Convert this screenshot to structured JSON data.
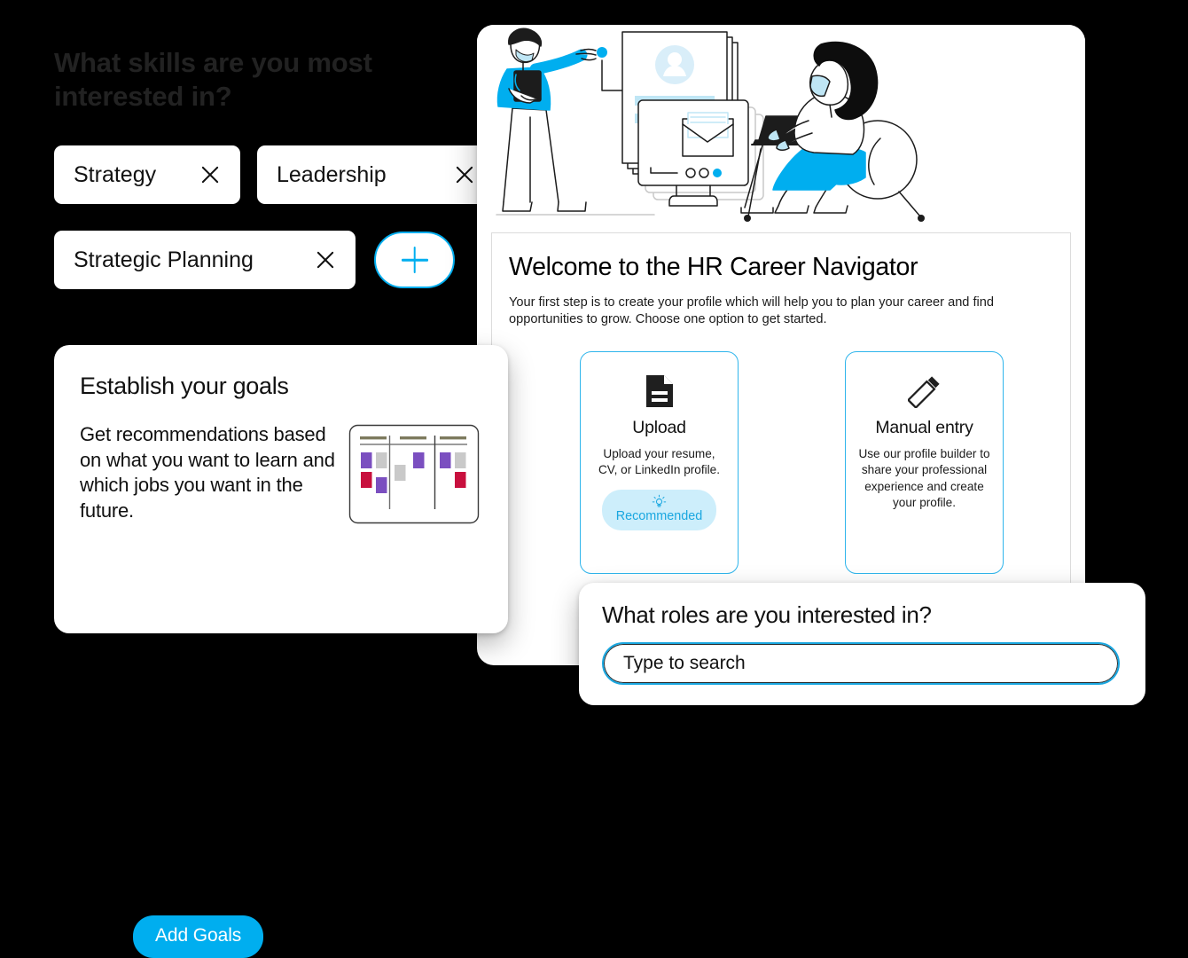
{
  "skills_panel": {
    "heading": "What skills are you most interested in?",
    "chips": [
      {
        "label": "Strategy",
        "remove_icon": "close-icon"
      },
      {
        "label": "Leadership",
        "remove_icon": "close-icon"
      },
      {
        "label": "Strategic Planning",
        "remove_icon": "close-icon"
      }
    ],
    "add_button": {
      "icon": "plus-icon",
      "label": ""
    }
  },
  "main_card": {
    "hero_illustration": "people-building-profile-illustration",
    "title": "Welcome to the HR Career Navigator",
    "subtitle": "Your first step is to create your profile which will help you to plan your career and find opportunities to grow. Choose one option to get started.",
    "options": [
      {
        "icon": "document-icon",
        "title": "Upload",
        "description": "Upload your resume, CV, or LinkedIn profile.",
        "badge": {
          "icon": "lightbulb-icon",
          "label": "Recommended"
        }
      },
      {
        "icon": "pencil-icon",
        "title": "Manual entry",
        "description": "Use our profile builder to share your professional experience and create your profile.",
        "badge": null
      }
    ]
  },
  "goals_card": {
    "title": "Establish your goals",
    "body": "Get recommendations based on what you want to learn and which jobs you want in the future.",
    "illustration": "kanban-board-icon",
    "button_label": "Add Goals"
  },
  "roles_card": {
    "title": "What roles are you interested in?",
    "search": {
      "value": "",
      "placeholder": "Type to search",
      "icon": "search-input"
    }
  },
  "colors": {
    "accent_blue": "#00AEEF",
    "accent_blue_border": "#1aa7e0",
    "badge_bg": "#cdeefb",
    "page_bg": "#000000",
    "card_bg": "#ffffff",
    "heading_on_black": "#222222",
    "kanban_purple": "#7B4FC0",
    "kanban_crimson": "#C8103E",
    "kanban_grey": "#C9C9C9",
    "illustration_blue": "#00AEEF",
    "illustration_light_blue": "#BFE6F5"
  }
}
